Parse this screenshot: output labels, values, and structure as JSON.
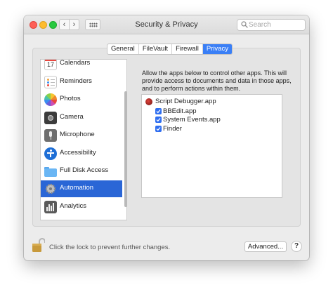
{
  "window": {
    "title": "Security & Privacy"
  },
  "toolbar": {
    "back": "‹",
    "forward": "›"
  },
  "search": {
    "placeholder": "Search"
  },
  "tabs": [
    {
      "label": "General",
      "active": false
    },
    {
      "label": "FileVault",
      "active": false
    },
    {
      "label": "Firewall",
      "active": false
    },
    {
      "label": "Privacy",
      "active": true
    }
  ],
  "sidebar": {
    "items": [
      {
        "label": "Calendars",
        "icon": "calendar-icon",
        "badge": "17"
      },
      {
        "label": "Reminders",
        "icon": "reminders-icon"
      },
      {
        "label": "Photos",
        "icon": "photos-icon"
      },
      {
        "label": "Camera",
        "icon": "camera-icon"
      },
      {
        "label": "Microphone",
        "icon": "microphone-icon"
      },
      {
        "label": "Accessibility",
        "icon": "accessibility-icon"
      },
      {
        "label": "Full Disk Access",
        "icon": "folder-icon"
      },
      {
        "label": "Automation",
        "icon": "gear-icon",
        "selected": true
      },
      {
        "label": "Analytics",
        "icon": "analytics-icon"
      }
    ]
  },
  "main": {
    "description": "Allow the apps below to control other apps. This will provide access to documents and data in those apps, and to perform actions within them.",
    "parent_app": {
      "label": "Script Debugger.app",
      "icon": "script-debugger-icon"
    },
    "controlled_apps": [
      {
        "label": "BBEdit.app",
        "checked": true
      },
      {
        "label": "System Events.app",
        "checked": true
      },
      {
        "label": "Finder",
        "checked": true
      }
    ]
  },
  "footer": {
    "lock_text": "Click the lock to prevent further changes.",
    "advanced_label": "Advanced...",
    "help_label": "?"
  },
  "colors": {
    "accent": "#3a7ff6",
    "selection": "#2a66d6",
    "window": "#ececec"
  }
}
